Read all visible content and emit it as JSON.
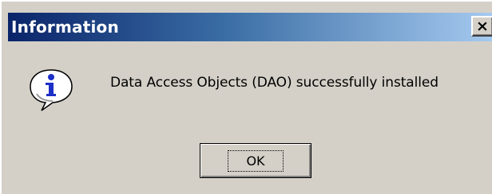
{
  "dialog": {
    "title": "Information",
    "close_symbol": "✕",
    "icon": "information-icon",
    "message": "Data Access Objects (DAO) successfully installed",
    "ok_label": "OK"
  },
  "colors": {
    "titlebar_start": "#0a246a",
    "titlebar_end": "#a6caf0",
    "face": "#d4d0c8",
    "icon_blue": "#1c2fc8"
  }
}
